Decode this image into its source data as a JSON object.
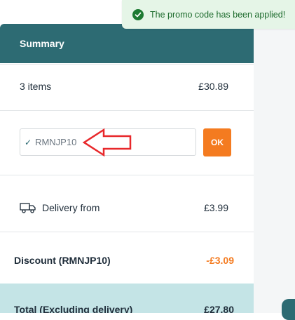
{
  "toast": {
    "message": "The promo code has been applied!",
    "icon": "check-circle-icon",
    "color": "#1d7a32",
    "background": "#e5f5e7"
  },
  "summary": {
    "title": "Summary",
    "header_color": "#2d6b73",
    "items_label": "3 items",
    "items_amount": "£30.89",
    "promo": {
      "value": "RMNJP10",
      "check_icon": "checkmark-icon",
      "button_label": "OK",
      "button_color": "#f47b20"
    },
    "delivery": {
      "icon": "delivery-truck-icon",
      "label": "Delivery from",
      "amount": "£3.99"
    },
    "discount": {
      "label": "Discount (RMNJP10)",
      "amount": "-£3.09"
    },
    "total": {
      "label": "Total (Excluding delivery)",
      "amount": "£27.80"
    }
  }
}
